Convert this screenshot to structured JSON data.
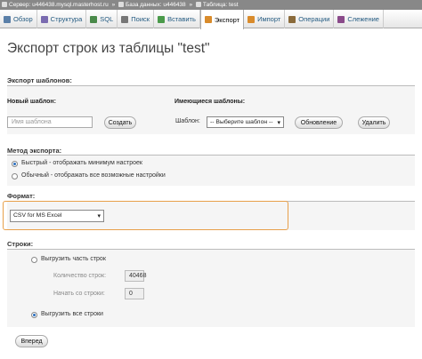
{
  "breadcrumb": {
    "server": "Сервер: u446438.mysql.masterhost.ru",
    "database": "База данных: u446438",
    "table": "Таблица: test"
  },
  "tabs": [
    {
      "label": "Обзор",
      "icon": "browse-icon",
      "color": "#5a7fa8"
    },
    {
      "label": "Структура",
      "icon": "structure-icon",
      "color": "#7a6bb0"
    },
    {
      "label": "SQL",
      "icon": "sql-icon",
      "color": "#4a8a4a"
    },
    {
      "label": "Поиск",
      "icon": "search-icon",
      "color": "#777777"
    },
    {
      "label": "Вставить",
      "icon": "insert-icon",
      "color": "#4a9a4a"
    },
    {
      "label": "Экспорт",
      "icon": "export-icon",
      "color": "#d98b2b"
    },
    {
      "label": "Импорт",
      "icon": "import-icon",
      "color": "#d98b2b"
    },
    {
      "label": "Операции",
      "icon": "operations-icon",
      "color": "#8a6a3a"
    },
    {
      "label": "Слежение",
      "icon": "tracking-icon",
      "color": "#8a4a8a"
    }
  ],
  "active_tab": "Экспорт",
  "page_title": "Экспорт строк из таблицы \"test\"",
  "templates": {
    "legend": "Экспорт шаблонов:",
    "new_label": "Новый шаблон:",
    "name_placeholder": "Имя шаблона",
    "create_button": "Создать",
    "existing_label": "Имеющиеся шаблоны:",
    "template_label": "Шаблон:",
    "template_select": "-- Выберите шаблон --",
    "update_button": "Обновление",
    "delete_button": "Удалить"
  },
  "method": {
    "legend": "Метод экспорта:",
    "options": [
      {
        "label": "Быстрый - отображать минимум настроек",
        "selected": true
      },
      {
        "label": "Обычный - отображать все возможные настройки",
        "selected": false
      }
    ]
  },
  "format": {
    "legend": "Формат:",
    "selected": "CSV for MS Excel"
  },
  "rows": {
    "legend": "Строки:",
    "some_rows_label": "Выгрузить часть строк",
    "count_label": "Количество строк:",
    "count_value": "40468",
    "start_label": "Начать со строки:",
    "start_value": "0",
    "all_rows_label": "Выгрузить все строки",
    "some_selected": false,
    "all_selected": true
  },
  "submit_button": "Вперед"
}
